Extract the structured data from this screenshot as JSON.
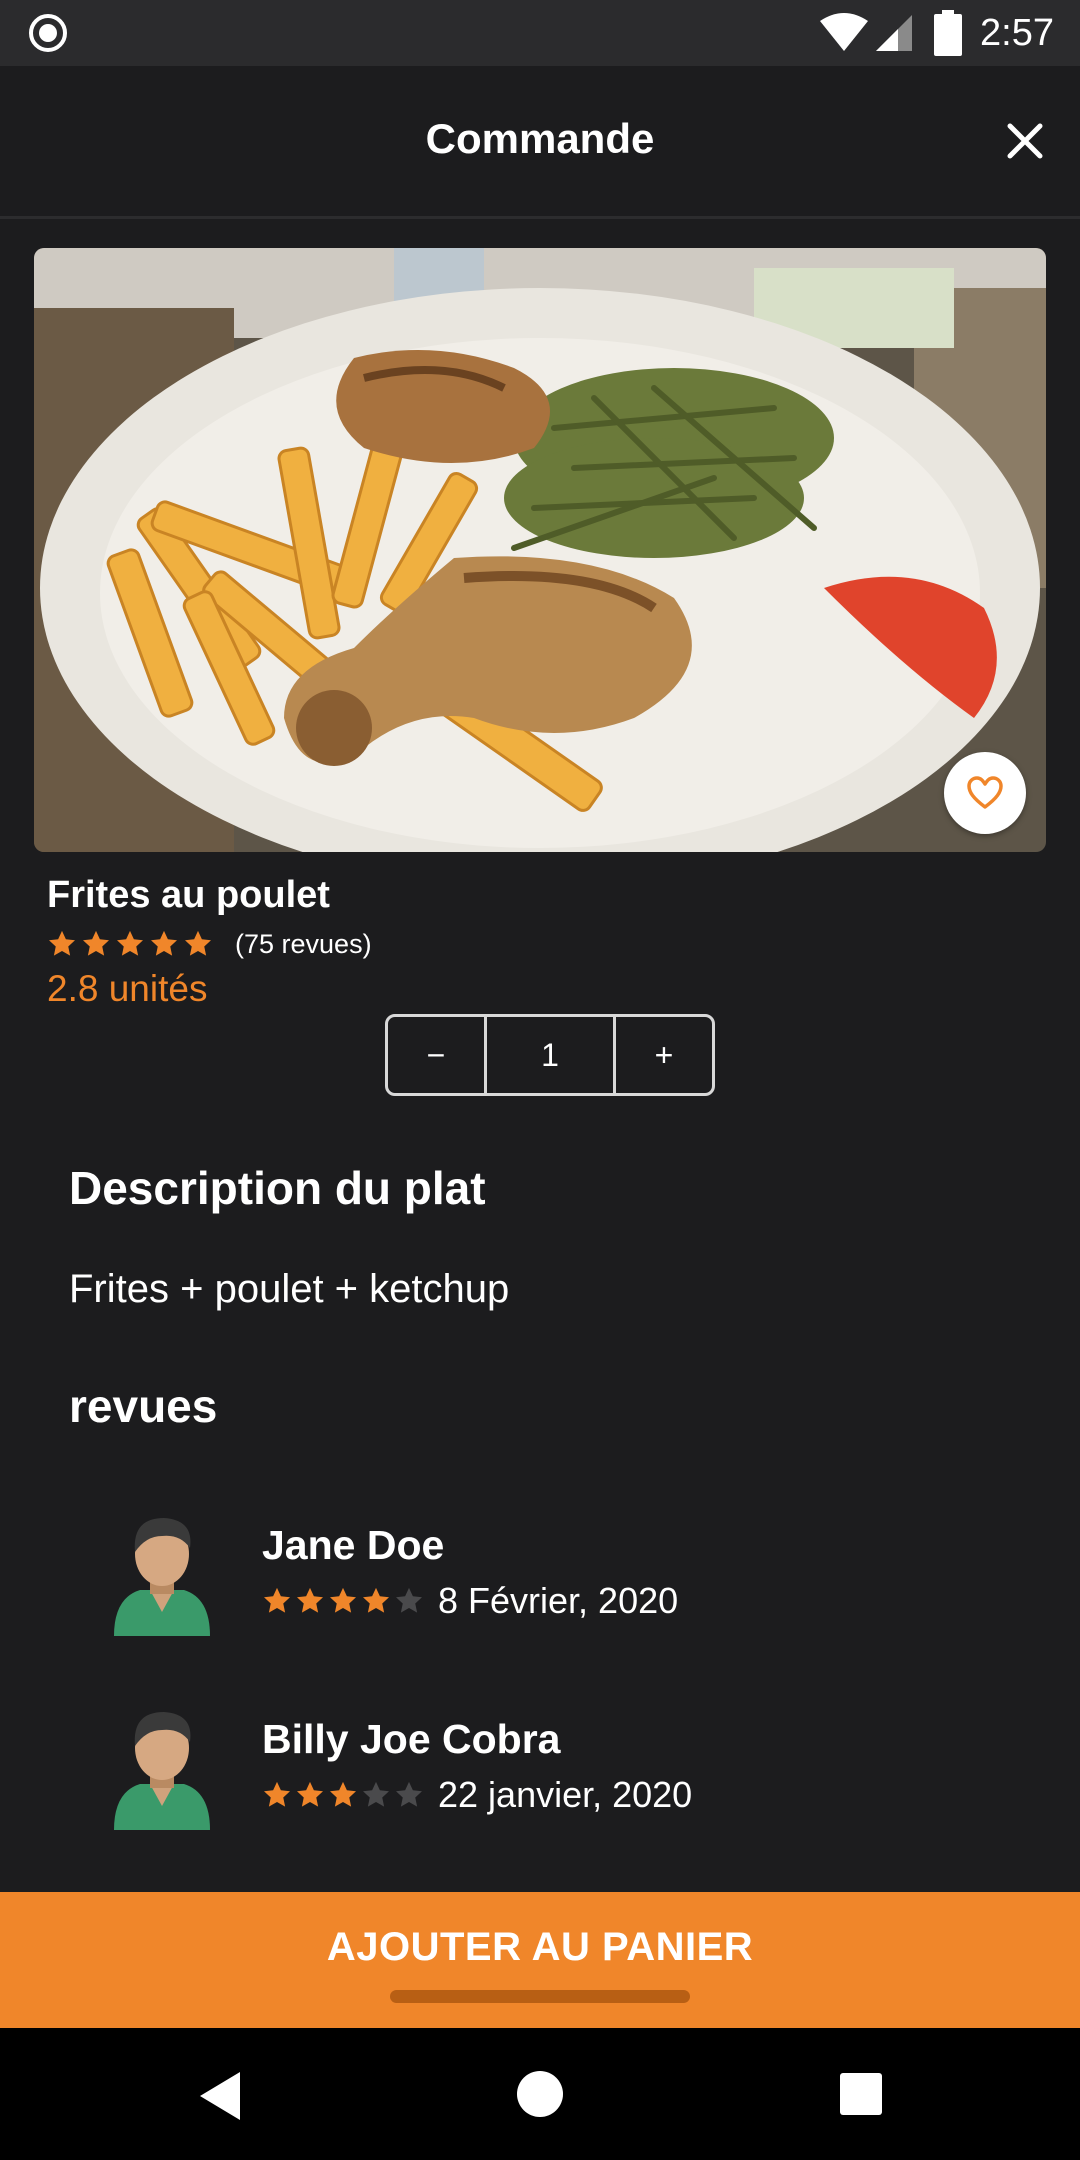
{
  "status_bar": {
    "time": "2:57"
  },
  "header": {
    "title": "Commande"
  },
  "dish": {
    "name": "Frites au poulet",
    "rating": 5,
    "review_count_label": "(75 revues)",
    "price_label": "2.8 unités",
    "quantity": "1",
    "minus_label": "−",
    "plus_label": "+"
  },
  "description": {
    "title": "Description du plat",
    "text": "Frites + poulet + ketchup"
  },
  "reviews": {
    "title": "revues",
    "items": [
      {
        "name": "Jane Doe",
        "rating": 4,
        "date": "8 Février, 2020"
      },
      {
        "name": "Billy Joe Cobra",
        "rating": 3,
        "date": "22 janvier, 2020"
      }
    ]
  },
  "cart": {
    "label": "AJOUTER AU PANIER"
  },
  "colors": {
    "accent": "#f0862a",
    "background": "#1c1c1e",
    "star_empty": "#4a4a4c"
  },
  "icons": [
    "record-icon",
    "wifi-icon",
    "signal-icon",
    "battery-icon",
    "close-icon",
    "heart-icon",
    "star-icon",
    "avatar-icon",
    "back-icon",
    "home-icon",
    "recents-icon"
  ]
}
